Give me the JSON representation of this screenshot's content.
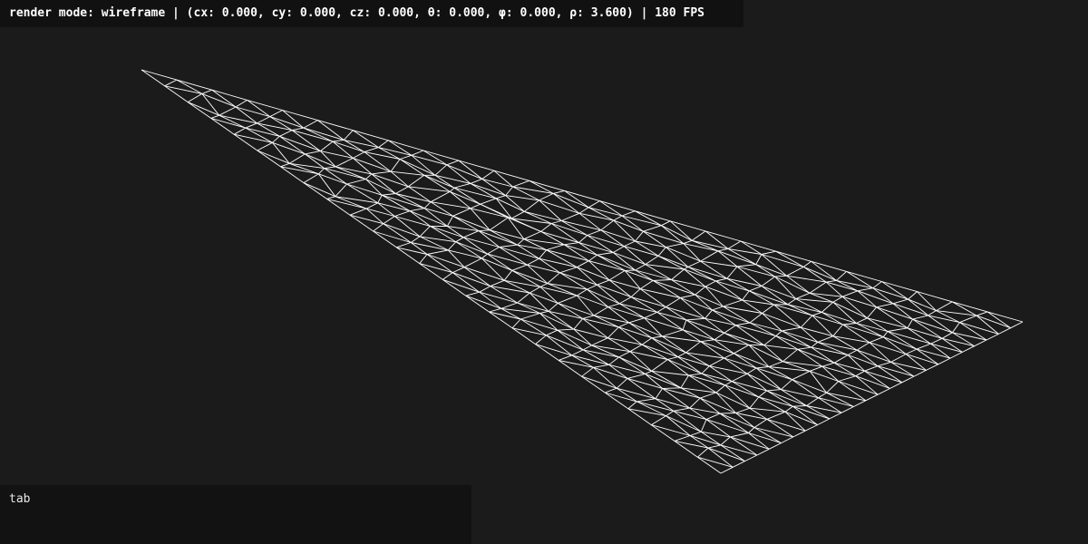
{
  "status_bar": {
    "text": "render mode: wireframe | (cx: 0.000, cy: 0.000, cz: 0.000, θ: 0.000, φ: 0.000, ρ: 3.600) | 180 FPS"
  },
  "console": {
    "text": "tab"
  },
  "viewport": {
    "background_color": "#1b1b1b",
    "line_color": "#ffffff"
  }
}
